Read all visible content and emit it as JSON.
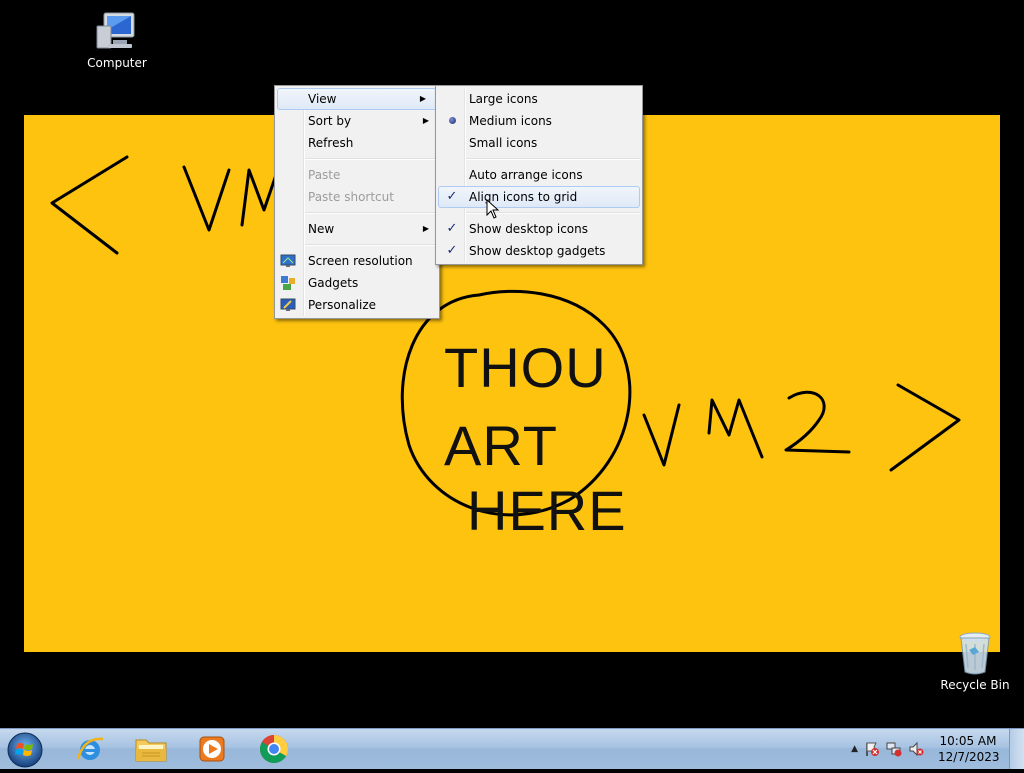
{
  "desktop": {
    "icons": {
      "computer": "Computer",
      "recycle_bin": "Recycle Bin"
    },
    "wallpaper": {
      "color": "#fdc30f",
      "text_line1": "THOU",
      "text_line2": "ART",
      "text_line3": "HERE",
      "left_label": "VM",
      "right_label": "VM2"
    }
  },
  "context_menu": {
    "view": "View",
    "sort_by": "Sort by",
    "refresh": "Refresh",
    "paste": "Paste",
    "paste_shortcut": "Paste shortcut",
    "new": "New",
    "screen_resolution": "Screen resolution",
    "gadgets": "Gadgets",
    "personalize": "Personalize"
  },
  "view_submenu": {
    "large_icons": "Large icons",
    "medium_icons": "Medium icons",
    "small_icons": "Small icons",
    "auto_arrange": "Auto arrange icons",
    "align_to_grid": "Align icons to grid",
    "show_desktop_icons": "Show desktop icons",
    "show_desktop_gadgets": "Show desktop gadgets",
    "check_glyph": "✓"
  },
  "taskbar": {
    "apps": [
      "internet-explorer",
      "windows-explorer",
      "media-player",
      "chrome"
    ],
    "tray_arrow": "▲",
    "time": "10:05 AM",
    "date": "12/7/2023"
  }
}
